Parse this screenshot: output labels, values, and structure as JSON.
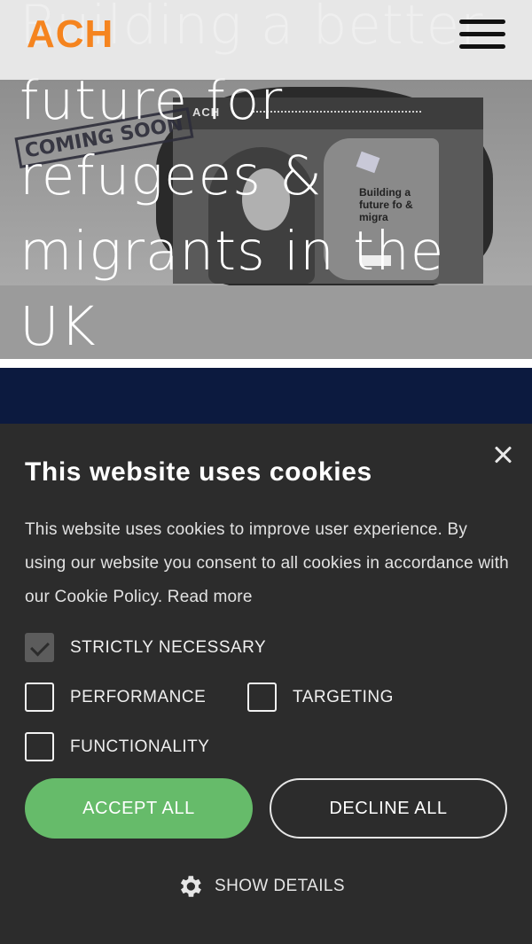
{
  "header": {
    "logo_text": "ACH",
    "brand_color": "#f5841f",
    "menu_icon": "hamburger-menu-icon"
  },
  "hero": {
    "headline": "Building a better future for refugees & migrants in the UK",
    "image": {
      "stamp_text": "COMING SOON",
      "screen_logo": "ACH",
      "panel_text": "Building a future fo & migra"
    }
  },
  "cookie_banner": {
    "title": "This website uses cookies",
    "body": "This website uses cookies to improve user experience. By using our website you consent to all cookies in accordance with our Cookie Policy.",
    "read_more": "Read more",
    "options": [
      {
        "label": "Strictly necessary",
        "checked": true,
        "disabled": true
      },
      {
        "label": "Performance",
        "checked": false,
        "disabled": false
      },
      {
        "label": "Targeting",
        "checked": false,
        "disabled": false
      },
      {
        "label": "Functionality",
        "checked": false,
        "disabled": false
      }
    ],
    "accept_label": "ACCEPT ALL",
    "decline_label": "DECLINE ALL",
    "show_details_label": "SHOW DETAILS",
    "accept_color": "#66bb6a",
    "panel_color": "#2c2c2c"
  },
  "colors": {
    "navy_band": "#0c1a3f"
  }
}
